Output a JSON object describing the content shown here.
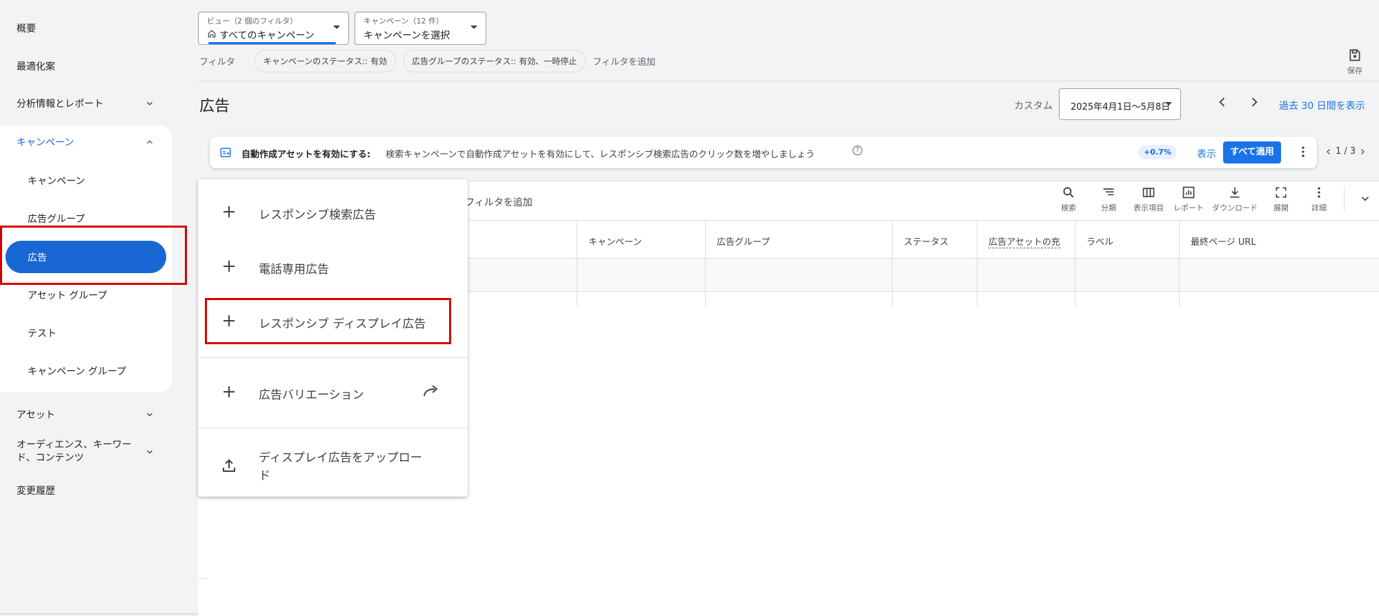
{
  "sidebar": {
    "overview": "概要",
    "recommendations": "最適化案",
    "insights": "分析情報とレポート",
    "campaigns_section": "キャンペーン",
    "sub_items": [
      "キャンペーン",
      "広告グループ",
      "広告",
      "アセット グループ",
      "テスト",
      "キャンペーン グループ"
    ],
    "assets": "アセット",
    "audiences": "オーディエンス、キーワード、コンテンツ",
    "change_history": "変更履歴"
  },
  "view_dropdown": {
    "label": "ビュー（2 個のフィルタ）",
    "value": "すべてのキャンペーン"
  },
  "campaign_dropdown": {
    "label": "キャンペーン（12 件）",
    "value": "キャンペーンを選択"
  },
  "filter_bar": {
    "label": "フィルタ",
    "chips": [
      "キャンペーンのステータス:: 有効",
      "広告グループのステータス:: 有効、一時停止"
    ],
    "add": "フィルタを追加"
  },
  "save_label": "保存",
  "page_title": "広告",
  "date_range": {
    "custom_label": "カスタム",
    "value": "2025年4月1日～5月8日",
    "past_link": "過去 30 日間を表示"
  },
  "banner": {
    "title": "自動作成アセットを有効にする:",
    "text": "検索キャンペーンで自動作成アセットを有効にして、レスポンシブ検索広告のクリック数を増やしましょう",
    "help": "?",
    "badge": "+0.7%",
    "show": "表示",
    "apply": "すべて適用",
    "pager": "1 / 3"
  },
  "table": {
    "filter_add": "フィルタを追加",
    "tools": [
      "検索",
      "分類",
      "表示項目",
      "レポート",
      "ダウンロード",
      "展開",
      "詳細"
    ],
    "columns": [
      "キャンペーン",
      "広告グループ",
      "ステータス",
      "広告アセットの充",
      "ラベル",
      "最終ページ URL"
    ]
  },
  "menu": {
    "items": [
      "レスポンシブ検索広告",
      "電話専用広告",
      "レスポンシブ ディスプレイ広告",
      "広告バリエーション",
      "ディスプレイ広告をアップロード"
    ],
    "upload_line2": "ド"
  },
  "colors": {
    "accent": "#1a73e8",
    "active_nav": "#1967d2",
    "highlight": "#d50000"
  }
}
